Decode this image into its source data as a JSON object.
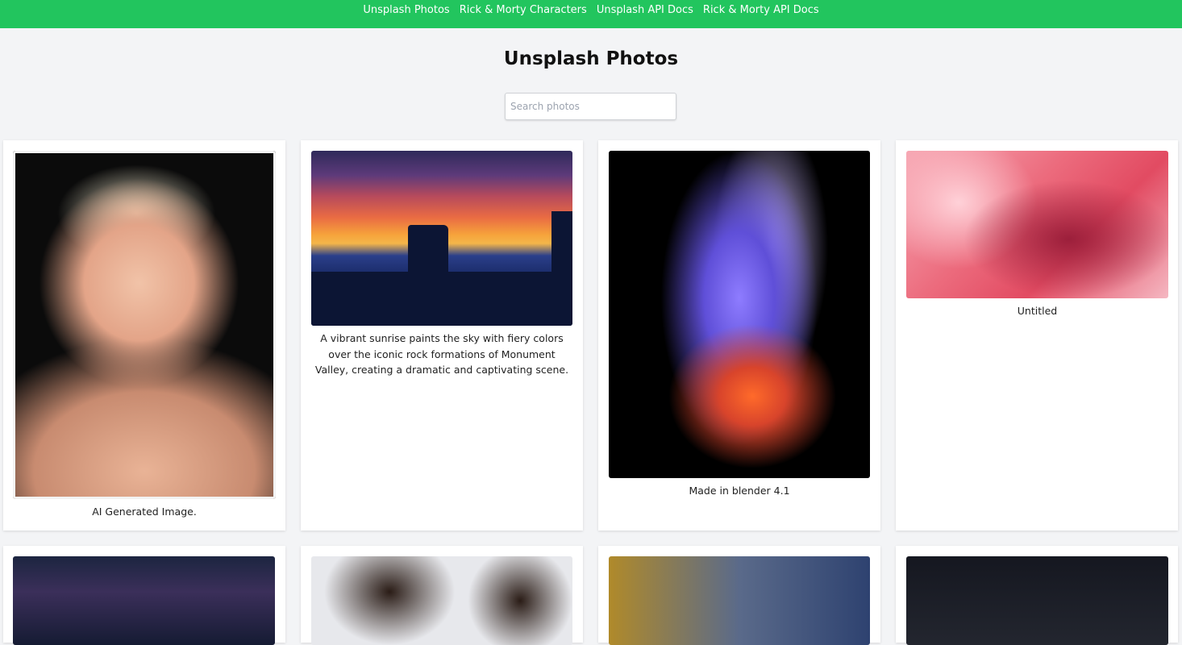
{
  "nav": {
    "links": [
      {
        "label": "Unsplash Photos"
      },
      {
        "label": "Rick & Morty Characters"
      },
      {
        "label": "Unsplash API Docs"
      },
      {
        "label": "Rick & Morty API Docs"
      }
    ]
  },
  "page": {
    "title": "Unsplash Photos"
  },
  "search": {
    "placeholder": "Search photos",
    "value": ""
  },
  "photos": [
    {
      "caption": "AI Generated Image."
    },
    {
      "caption": "A vibrant sunrise paints the sky with fiery colors over the iconic rock formations of Monument Valley, creating a dramatic and captivating scene."
    },
    {
      "caption": "Made in blender 4.1"
    },
    {
      "caption": "Untitled"
    },
    {
      "caption": ""
    },
    {
      "caption": ""
    },
    {
      "caption": ""
    },
    {
      "caption": ""
    }
  ],
  "colors": {
    "nav_bg": "#22c55e",
    "page_bg": "#f3f4f6",
    "card_bg": "#ffffff"
  }
}
